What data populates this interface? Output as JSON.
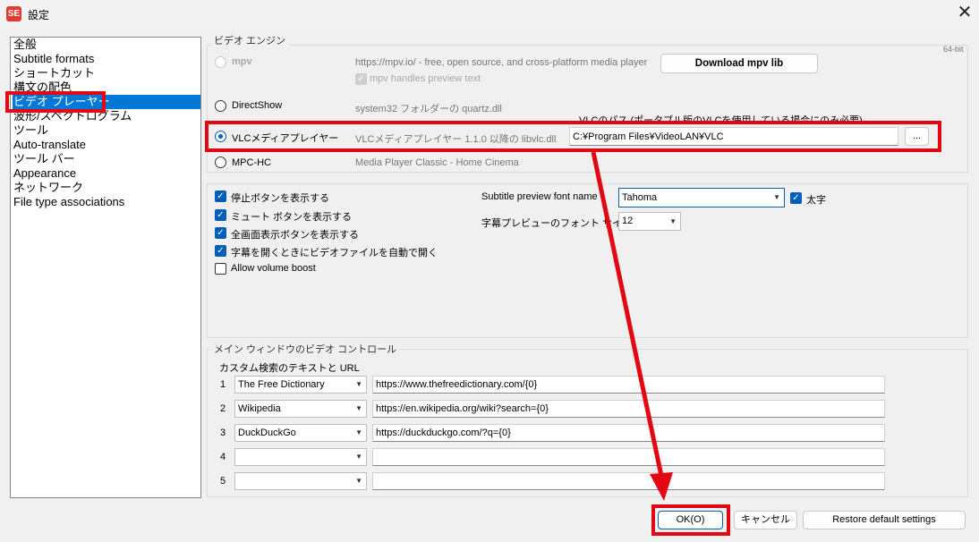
{
  "window": {
    "title": "設定",
    "app_icon_text": "SE",
    "close_glyph": "✕"
  },
  "sidebar": {
    "items": [
      {
        "label": "全般"
      },
      {
        "label": "Subtitle formats"
      },
      {
        "label": "ショートカット"
      },
      {
        "label": "構文の配色"
      },
      {
        "label": "ビデオ プレーヤー",
        "selected": true
      },
      {
        "label": "波形/スペクトログラム"
      },
      {
        "label": "ツール"
      },
      {
        "label": "Auto-translate"
      },
      {
        "label": "ツール バー"
      },
      {
        "label": "Appearance"
      },
      {
        "label": "ネットワーク"
      },
      {
        "label": "File type associations"
      }
    ]
  },
  "video_engine": {
    "group_label": "ビデオ エンジン",
    "bitness": "64-bit",
    "engines": [
      {
        "name": "mpv",
        "desc": "https://mpv.io/ - free, open source, and cross-platform media player"
      },
      {
        "name": "DirectShow",
        "desc": "system32 フォルダーの quartz.dll"
      },
      {
        "name": "VLCメディアプレイヤー",
        "desc": "VLCメディアプレイヤー 1.1.0 以降の libvlc.dll",
        "selected": true
      },
      {
        "name": "MPC-HC",
        "desc": "Media Player Classic - Home Cinema"
      }
    ],
    "download_mpv_label": "Download mpv lib",
    "mpv_preview_label": "mpv handles preview text",
    "vlc_path_label": "VLCのパス (ポータブル版のVLCを使用している場合にのみ必要)",
    "vlc_path_value": "C:¥Program Files¥VideoLAN¥VLC",
    "browse_label": "..."
  },
  "options": {
    "checkboxes": [
      {
        "label": "停止ボタンを表示する",
        "checked": true
      },
      {
        "label": "ミュート ボタンを表示する",
        "checked": true
      },
      {
        "label": "全画面表示ボタンを表示する",
        "checked": true
      },
      {
        "label": "字幕を開くときにビデオファイルを自動で開く",
        "checked": true
      },
      {
        "label": "Allow volume boost",
        "checked": false
      }
    ],
    "font_name_label": "Subtitle preview font name",
    "font_name_value": "Tahoma",
    "bold_label": "太字",
    "font_size_label": "字幕プレビューのフォント サイズ",
    "font_size_value": "12"
  },
  "main_window": {
    "group_label": "メイン ウィンドウのビデオ コントロール",
    "custom_search_label": "カスタム検索のテキストと URL",
    "rows": [
      {
        "num": "1",
        "name": "The Free Dictionary",
        "url": "https://www.thefreedictionary.com/{0}"
      },
      {
        "num": "2",
        "name": "Wikipedia",
        "url": "https://en.wikipedia.org/wiki?search={0}"
      },
      {
        "num": "3",
        "name": "DuckDuckGo",
        "url": "https://duckduckgo.com/?q={0}"
      },
      {
        "num": "4",
        "name": "",
        "url": ""
      },
      {
        "num": "5",
        "name": "",
        "url": ""
      }
    ]
  },
  "footer": {
    "ok_label": "OK(O)",
    "cancel_label": "キャンセル",
    "restore_label": "Restore default settings"
  },
  "colors": {
    "accent": "#0078d7",
    "annotation": "#e30613"
  }
}
